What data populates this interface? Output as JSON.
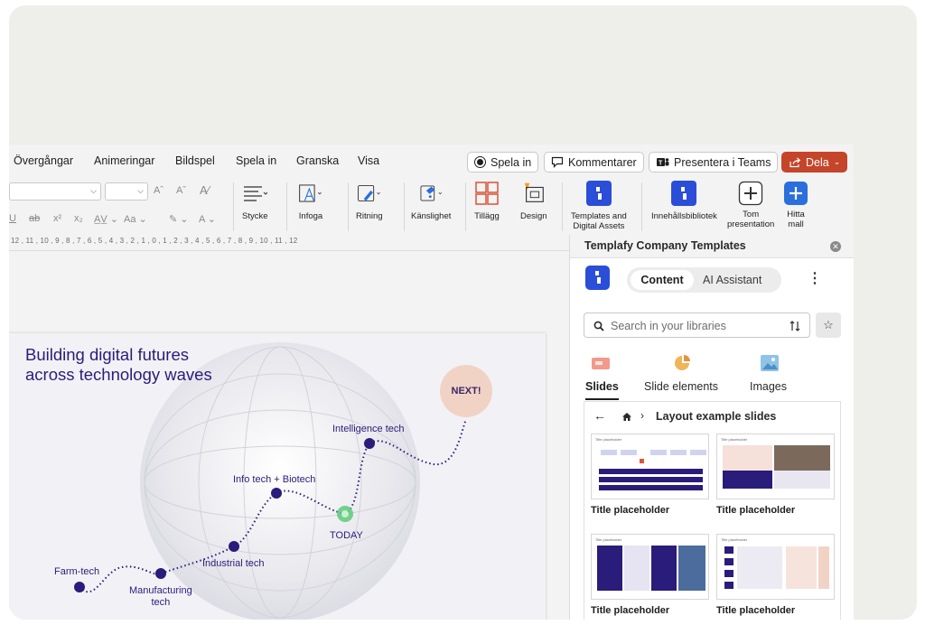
{
  "menu": {
    "items": [
      "Övergångar",
      "Animeringar",
      "Bildspel",
      "Spela in",
      "Granska",
      "Visa"
    ],
    "record_label": "Spela in",
    "comments_label": "Kommentarer",
    "teams_label": "Presentera i Teams",
    "share_label": "Dela"
  },
  "ribbon": {
    "paragraph_label": "Stycke",
    "insert_label": "Infoga",
    "drawing_label": "Ritning",
    "sensitivity_label": "Känslighet",
    "addins_label": "Tillägg",
    "design_label": "Design",
    "templates_label_1": "Templates and",
    "templates_label_2": "Digital Assets",
    "library_label": "Innehållsbibliotek",
    "blank_label_1": "Tom",
    "blank_label_2": "presentation",
    "find_label_1": "Hitta",
    "find_label_2": "mall",
    "font_size_up": "Aˆ",
    "font_size_down": "Aˇ"
  },
  "ruler": {
    "ticks": "12 , 11 , 10 , 9 , 8 , 7 , 6 , 5 , 4 , 3 , 2 , 1 , 0 , 1 , 2 , 3 , 4 , 5 , 6 , 7 , 8 , 9 , 10 , 11 , 12"
  },
  "slide": {
    "title_line1": "Building digital futures",
    "title_line2": "across technology waves",
    "next_label": "NEXT!",
    "milestones": {
      "farm": "Farm-tech",
      "manufacturing_1": "Manufacturing",
      "manufacturing_2": "tech",
      "industrial": "Industrial tech",
      "info_bio": "Info tech + Biotech",
      "today": "TODAY",
      "intelligence": "Intelligence tech"
    }
  },
  "panel": {
    "title": "Templafy Company Templates",
    "tab_content": "Content",
    "tab_ai": "AI Assistant",
    "search_placeholder": "Search in your libraries",
    "tabs": [
      "Slides",
      "Slide elements",
      "Images"
    ],
    "breadcrumb": "Layout example slides",
    "thumbs": [
      {
        "caption": "Title placeholder",
        "mini_title": "Title placeholder"
      },
      {
        "caption": "Title placeholder",
        "mini_title": "Title placeholder"
      },
      {
        "caption": "Title placeholder",
        "mini_title": "Title placeholder"
      },
      {
        "caption": "Title placeholder",
        "mini_title": "Title placeholder"
      }
    ]
  },
  "colors": {
    "accent_blue": "#2a4ed8",
    "share_red": "#c4452a",
    "slide_navy": "#2a1c7a",
    "today_green": "#5ec97b",
    "next_peach": "#f1d3c6"
  }
}
